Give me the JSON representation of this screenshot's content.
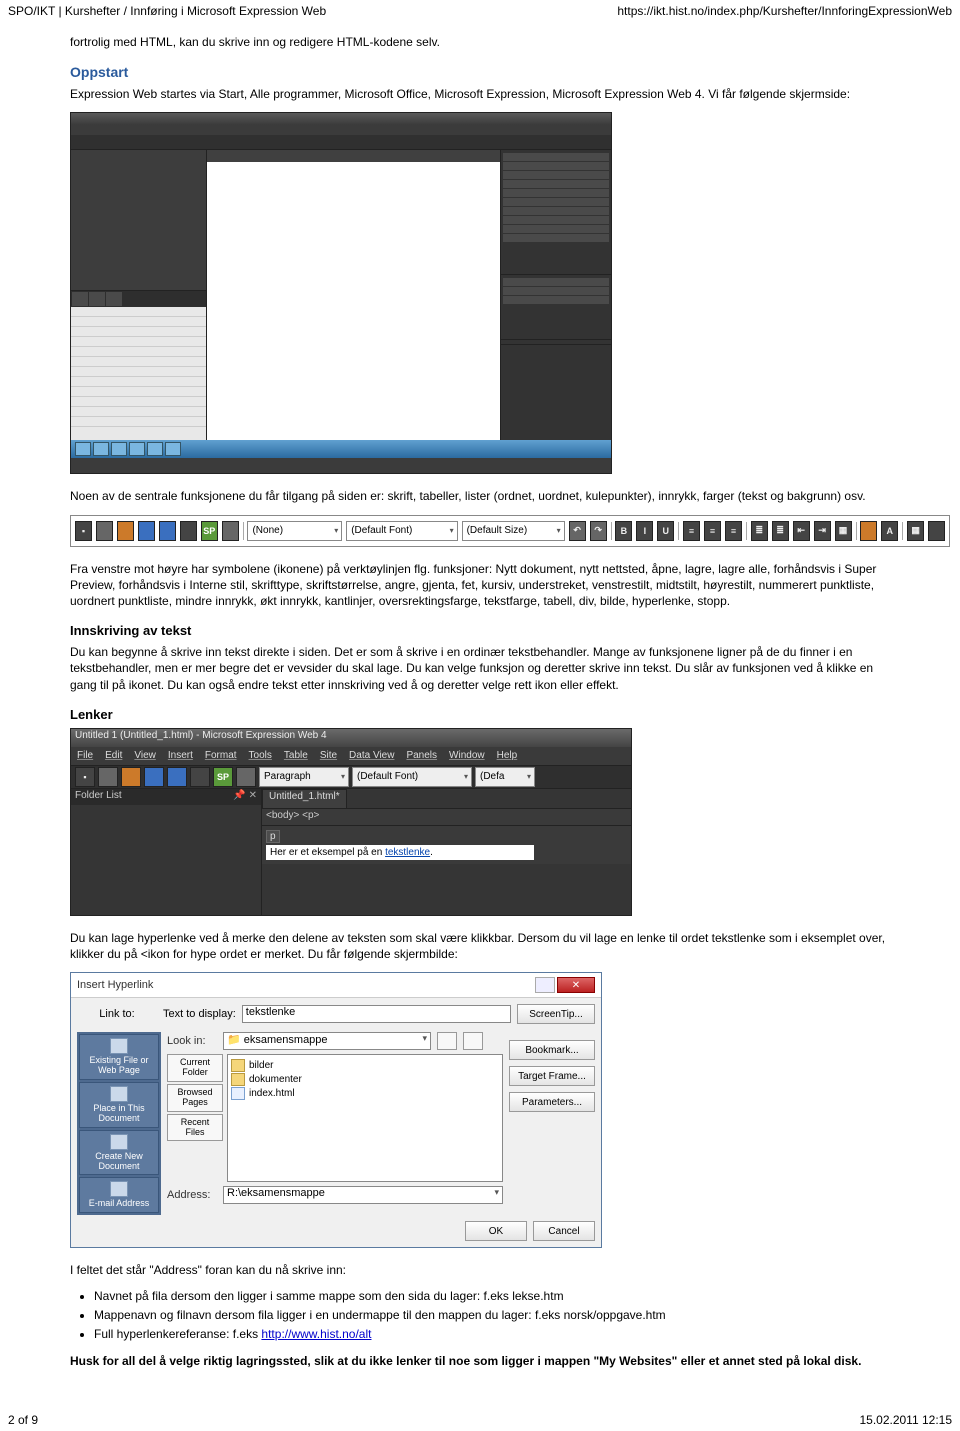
{
  "header": {
    "left": "SPO/IKT | Kurshefter / Innføring i Microsoft Expression Web",
    "right": "https://ikt.hist.no/index.php/Kurshefter/InnforingExpressionWeb"
  },
  "intro1": "fortrolig med HTML, kan du skrive inn og redigere HTML-kodene selv.",
  "h_oppstart": "Oppstart",
  "oppstart_p": "Expression Web startes via Start, Alle programmer, Microsoft Office, Microsoft Expression, Microsoft Expression Web 4. Vi får følgende skjermside:",
  "after_ide": "Noen av de sentrale funksjonene du får tilgang på siden er: skrift, tabeller, lister (ordnet, uordnet, kulepunkter), innrykk, farger (tekst og bakgrunn) osv.",
  "toolbar": {
    "style": "(None)",
    "font": "(Default Font)",
    "size": "(Default Size)"
  },
  "after_tb_p1": "Fra venstre mot høyre har symbolene (ikonene) på verktøylinjen flg. funksjoner: Nytt dokument, nytt nettsted, åpne, lagre, lagre alle, forhåndsvis i Super Preview, forhåndsvis i Interne stil, skrifttype, skriftstørrelse, angre, gjenta, fet, kursiv, understreket, venstrestilt, midtstilt, høyrestilt, nummerert punktliste, uordnert punktliste, mindre innrykk, økt innrykk, kantlinjer, oversrektingsfarge, tekstfarge, tabell, div, bilde, hyperlenke, stopp.",
  "h_innskriving": "Innskriving av tekst",
  "innskriving_p": "Du kan begynne å skrive inn tekst direkte i siden. Det er som å skrive i en ordinær tekstbehandler. Mange av funksjonene ligner på de du finner i en tekstbehandler, men er mer begre det er vevsider du skal lage. Du kan velge funksjon og deretter skrive inn tekst. Du slår av funksjonen ved å klikke en gang til på ikonet. Du kan også endre tekst etter innskriving ved å og deretter velge rett ikon eller effekt.",
  "h_lenker": "Lenker",
  "editor": {
    "title": "Untitled 1 (Untitled_1.html) - Microsoft Expression Web 4",
    "menu": [
      "File",
      "Edit",
      "View",
      "Insert",
      "Format",
      "Tools",
      "Table",
      "Site",
      "Data View",
      "Panels",
      "Window",
      "Help"
    ],
    "toolbar_style": "Paragraph",
    "toolbar_font": "(Default Font)",
    "toolbar_size": "(Defa",
    "folder_title": "Folder List",
    "tab": "Untitled_1.html*",
    "crumb": "<body> <p>",
    "ptag": "p",
    "line_pre": "Her er et eksempel på en ",
    "line_link": "tekstlenke",
    "line_post": "."
  },
  "after_editor_p": "Du kan lage hyperlenke ved å merke den delene av teksten som skal være klikkbar. Dersom du vil lage en lenke til ordet tekstlenke som i eksemplet over, klikker du på <ikon for hype ordet er merket. Du får følgende skjermbilde:",
  "dlg": {
    "title": "Insert Hyperlink",
    "linkto": "Link to:",
    "text_to_display_label": "Text to display:",
    "text_to_display_value": "tekstlenke",
    "lookin_label": "Look in:",
    "lookin_value": "eksamensmappe",
    "nav": [
      "Existing File or Web Page",
      "Place in This Document",
      "Create New Document",
      "E-mail Address"
    ],
    "subnav": [
      "Current Folder",
      "Browsed Pages",
      "Recent Files"
    ],
    "files": [
      {
        "name": "bilder",
        "type": "folder"
      },
      {
        "name": "dokumenter",
        "type": "folder"
      },
      {
        "name": "index.html",
        "type": "html"
      }
    ],
    "address_label": "Address:",
    "address_value": "R:\\eksamensmappe",
    "btn_screentip": "ScreenTip...",
    "btn_bookmark": "Bookmark...",
    "btn_target": "Target Frame...",
    "btn_params": "Parameters...",
    "btn_ok": "OK",
    "btn_cancel": "Cancel"
  },
  "after_dlg_p": "I feltet det står \"Address\" foran kan du nå skrive inn:",
  "bullets": [
    "Navnet på fila dersom den ligger i samme mappe som den sida du lager: f.eks lekse.htm",
    "Mappenavn og filnavn dersom fila ligger i en undermappe til den mappen du lager: f.eks norsk/oppgave.htm",
    "Full hyperlenkereferanse: f.eks "
  ],
  "bullet3_link": "http://www.hist.no/alt",
  "husk": "Husk for all del å velge riktig lagringssted, slik at du ikke lenker til noe som ligger i mappen \"My Websites\" eller et annet sted på lokal disk.",
  "footer": {
    "left": "2 of 9",
    "right": "15.02.2011 12:15"
  }
}
